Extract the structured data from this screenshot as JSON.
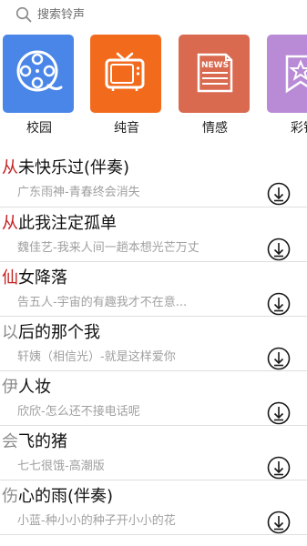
{
  "search": {
    "placeholder": "搜索铃声"
  },
  "categories": [
    {
      "label": "校园",
      "icon": "film-reel-icon",
      "color": "#4a86e8"
    },
    {
      "label": "纯音",
      "icon": "television-icon",
      "color": "#f26b1d"
    },
    {
      "label": "情感",
      "icon": "news-icon",
      "color": "#d9694f"
    },
    {
      "label": "彩铃",
      "icon": "star-bookmark-icon",
      "color": "#b98bd6"
    }
  ],
  "songs": [
    {
      "initial": "从",
      "rest": "未快乐过(伴奏)",
      "subtitle": "广东雨神-青春终会消失",
      "initial_color": "#c41f1f"
    },
    {
      "initial": "从",
      "rest": "此我注定孤单",
      "subtitle": "魏佳艺-我来人间一趟本想光芒万丈",
      "initial_color": "#c41f1f"
    },
    {
      "initial": "仙",
      "rest": "女降落",
      "subtitle": "告五人-宇宙的有趣我才不在意...",
      "initial_color": "#c41f1f"
    },
    {
      "initial": "以",
      "rest": "后的那个我",
      "subtitle": "轩姨（相信光）-就是这样爱你",
      "initial_color": "#8c8c8c"
    },
    {
      "initial": "伊",
      "rest": "人妆",
      "subtitle": "欣欣-怎么还不接电话呢",
      "initial_color": "#8c8c8c"
    },
    {
      "initial": "会",
      "rest": "飞的猪",
      "subtitle": "七七很饿-高潮版",
      "initial_color": "#8c8c8c"
    },
    {
      "initial": "伤",
      "rest": "心的雨(伴奏)",
      "subtitle": "小蓝-种小小的种子开小小的花",
      "initial_color": "#8c8c8c"
    }
  ]
}
